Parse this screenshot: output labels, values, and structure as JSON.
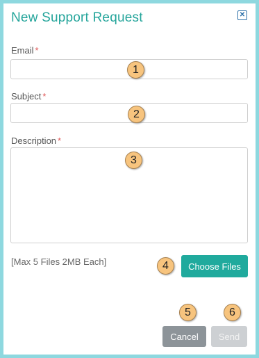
{
  "dialog": {
    "title": "New Support Request",
    "close_icon": "close-icon",
    "accent_color": "#25a59b"
  },
  "form": {
    "email": {
      "label": "Email",
      "required_mark": "*",
      "value": "",
      "badge": "1"
    },
    "subject": {
      "label": "Subject",
      "required_mark": "*",
      "value": "",
      "badge": "2"
    },
    "description": {
      "label": "Description",
      "required_mark": "*",
      "value": "",
      "badge": "3"
    },
    "attachments": {
      "hint": "[Max 5 Files 2MB Each]",
      "button_label": "Choose Files",
      "badge": "4"
    }
  },
  "actions": {
    "cancel_label": "Cancel",
    "cancel_badge": "5",
    "send_label": "Send",
    "send_badge": "6"
  }
}
